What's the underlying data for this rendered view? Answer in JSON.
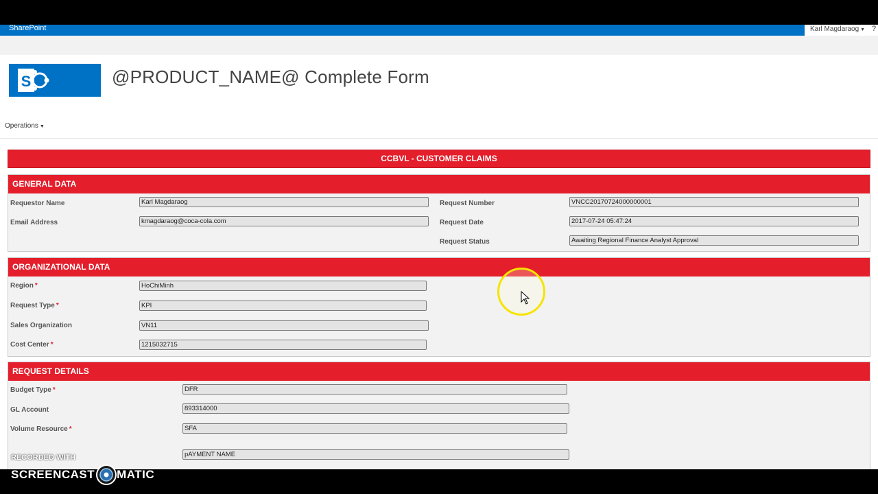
{
  "suite_bar": {
    "brand": "SharePoint",
    "user": "Karl Magdaraog",
    "help": "?"
  },
  "page_title": "@PRODUCT_NAME@ Complete Form",
  "operations_menu": "Operations",
  "form_title": "CCBVL - CUSTOMER CLAIMS",
  "general": {
    "heading": "GENERAL DATA",
    "requestor_name_label": "Requestor Name",
    "requestor_name": "Karl Magdaraog",
    "email_label": "Email Address",
    "email": "kmagdaraog@coca-cola.com",
    "request_number_label": "Request Number",
    "request_number": "VNCC20170724000000001",
    "request_date_label": "Request Date",
    "request_date": "2017-07-24 05:47:24",
    "request_status_label": "Request Status",
    "request_status": "Awaiting Regional Finance Analyst Approval"
  },
  "organizational": {
    "heading": "ORGANIZATIONAL DATA",
    "region_label": "Region",
    "region": "HoChiMinh",
    "request_type_label": "Request Type",
    "request_type": "KPI",
    "sales_org_label": "Sales Organization",
    "sales_org": "VN11",
    "cost_center_label": "Cost Center",
    "cost_center": "1215032715"
  },
  "request_details": {
    "heading": "REQUEST DETAILS",
    "budget_type_label": "Budget Type",
    "budget_type": "DFR",
    "gl_account_label": "GL Account",
    "gl_account": "893314000",
    "volume_resource_label": "Volume Resource",
    "volume_resource": "SFA",
    "payment_name": "pAYMENT NAME"
  },
  "required_marker": "*",
  "watermark": {
    "recorded_with": "RECORDED WITH",
    "left": "SCREENCAST",
    "right": "MATIC"
  },
  "colors": {
    "brand_blue": "#0072c6",
    "section_red": "#e41e2b",
    "cursor_ring": "#f5e400"
  }
}
